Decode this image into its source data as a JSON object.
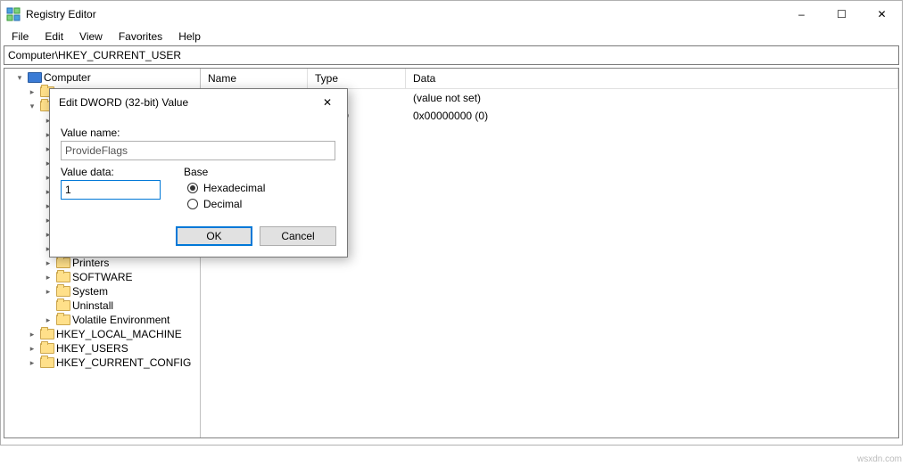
{
  "window": {
    "title": "Registry Editor",
    "minimize": "–",
    "maximize": "☐",
    "close": "✕"
  },
  "menu": {
    "file": "File",
    "edit": "Edit",
    "view": "View",
    "favorites": "Favorites",
    "help": "Help"
  },
  "address": "Computer\\HKEY_CURRENT_USER",
  "columns": {
    "name": "Name",
    "type": "Type",
    "data": "Data"
  },
  "rows": [
    {
      "name": "",
      "type": "",
      "data": "(value not set)"
    },
    {
      "name": "",
      "type": "WORD",
      "data": "0x00000000 (0)"
    }
  ],
  "tree": {
    "root": "Computer",
    "items": [
      {
        "label": "Printers"
      },
      {
        "label": "SOFTWARE"
      },
      {
        "label": "System"
      },
      {
        "label": "Uninstall"
      },
      {
        "label": "Volatile Environment"
      }
    ],
    "hives": [
      "HKEY_LOCAL_MACHINE",
      "HKEY_USERS",
      "HKEY_CURRENT_CONFIG"
    ]
  },
  "dialog": {
    "title": "Edit DWORD (32-bit) Value",
    "close": "✕",
    "value_name_label": "Value name:",
    "value_name": "ProvideFlags",
    "value_data_label": "Value data:",
    "value_data": "1",
    "base_label": "Base",
    "hex": "Hexadecimal",
    "dec": "Decimal",
    "ok": "OK",
    "cancel": "Cancel"
  },
  "watermark": "wsxdn.com"
}
